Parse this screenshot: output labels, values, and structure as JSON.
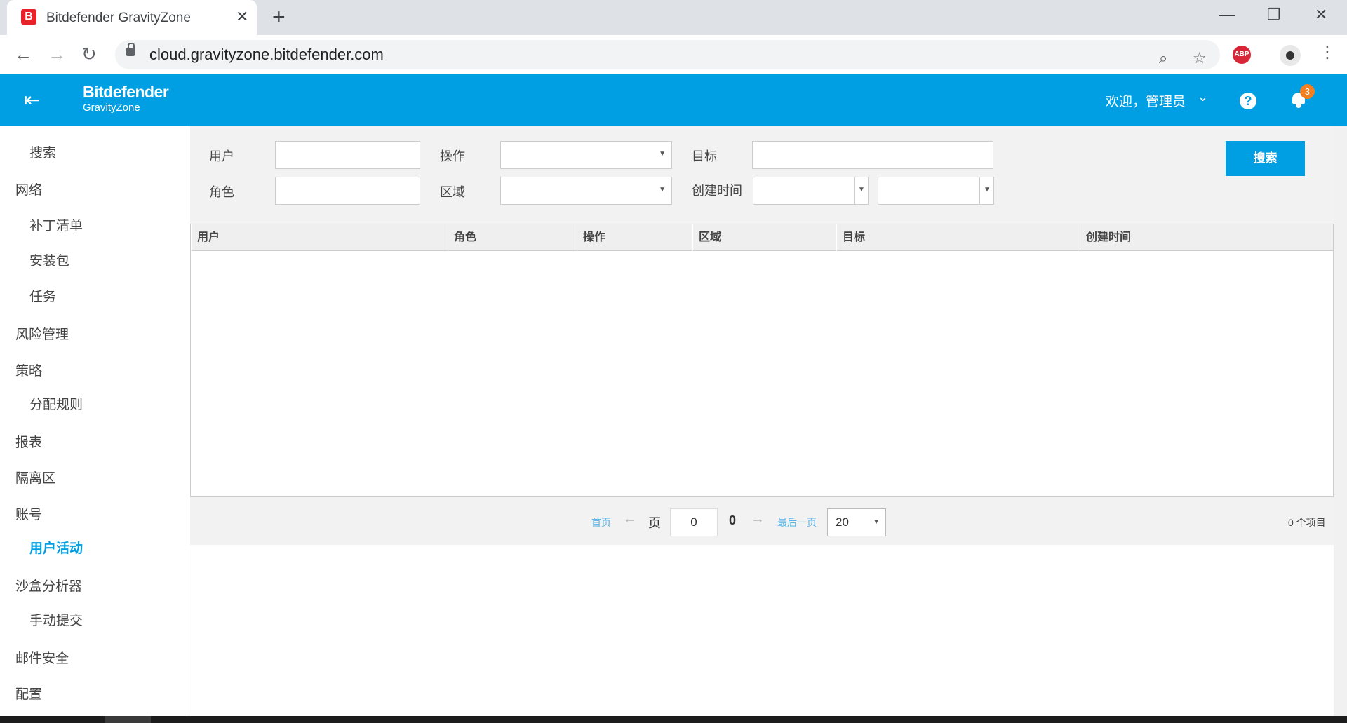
{
  "browser": {
    "tab_title": "Bitdefender GravityZone",
    "tab_favicon_letter": "B",
    "tab_close": "✕",
    "new_tab": "+",
    "url": "cloud.gravityzone.bitdefender.com",
    "abp_label": "ABP",
    "window_minimize": "—",
    "window_restore": "❐",
    "window_close": "✕"
  },
  "app": {
    "brand_name": "Bitdefender",
    "brand_product": "GravityZone",
    "welcome": "欢迎，管理员",
    "help": "?",
    "notifications_count": "3",
    "accent_color": "#009ee2"
  },
  "sidebar": {
    "items": [
      {
        "label": "搜索",
        "level": "sub"
      },
      {
        "label": "网络",
        "level": "top"
      },
      {
        "label": "补丁清单",
        "level": "sub"
      },
      {
        "label": "安装包",
        "level": "sub"
      },
      {
        "label": "任务",
        "level": "sub"
      },
      {
        "label": "风险管理",
        "level": "top"
      },
      {
        "label": "策略",
        "level": "top"
      },
      {
        "label": "分配规则",
        "level": "sub"
      },
      {
        "label": "报表",
        "level": "top"
      },
      {
        "label": "隔离区",
        "level": "top"
      },
      {
        "label": "账号",
        "level": "top"
      },
      {
        "label": "用户活动",
        "level": "sub",
        "active": true
      },
      {
        "label": "沙盒分析器",
        "level": "top"
      },
      {
        "label": "手动提交",
        "level": "sub"
      },
      {
        "label": "邮件安全",
        "level": "top"
      },
      {
        "label": "配置",
        "level": "top"
      }
    ]
  },
  "filters": {
    "user_label": "用户",
    "user_value": "",
    "action_label": "操作",
    "action_value": "",
    "target_label": "目标",
    "target_value": "",
    "role_label": "角色",
    "role_value": "",
    "area_label": "区域",
    "area_value": "",
    "created_label": "创建时间",
    "created_from": "",
    "created_to": "",
    "search_button": "搜索"
  },
  "table": {
    "columns": [
      "用户",
      "角色",
      "操作",
      "区域",
      "目标",
      "创建时间"
    ],
    "rows": []
  },
  "pager": {
    "first": "首页",
    "prev_arrow": "←",
    "page_label": "页",
    "page_input": "0",
    "total_pages": "0",
    "next_arrow": "→",
    "last": "最后一页",
    "page_size": "20",
    "item_count": "0 个项目"
  }
}
